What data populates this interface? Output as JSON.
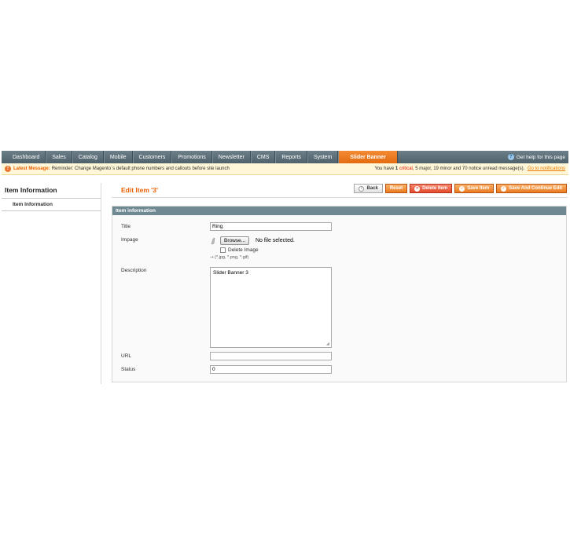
{
  "nav": {
    "items": [
      "Dashboard",
      "Sales",
      "Catalog",
      "Mobile",
      "Customers",
      "Promotions",
      "Newsletter",
      "CMS",
      "Reports",
      "System",
      "Slider Banner"
    ],
    "active_index": 10,
    "help_icon": "question-icon",
    "help_text": "Get help for this page"
  },
  "message": {
    "label": "Latest Message:",
    "text": "Reminder: Change Magento`s default phone numbers and callouts before site launch",
    "summary_prefix": "You have",
    "critical_count": "1",
    "critical_label": "critical",
    "major": ", 5 major, 19 minor and 70 notice unread message(s).",
    "link": "Go to notifications"
  },
  "sidebar": {
    "title": "Item Information",
    "tabs": [
      "Item Information"
    ]
  },
  "page": {
    "title": "Edit Item '3'"
  },
  "buttons": {
    "back": "Back",
    "reset": "Reset",
    "delete": "Delete Item",
    "save": "Save Item",
    "save_continue": "Save And Continue Edit"
  },
  "form": {
    "section_title": "Item information",
    "title_label": "Title",
    "title_value": "Ring",
    "image_label": "Impage",
    "browse_label": "Browse...",
    "no_file": "No file selected.",
    "delete_image_label": "Delete Image",
    "image_hint": "(*.jpg, *.png, *.gif)",
    "description_label": "Description",
    "description_value": "Slider Banner 3",
    "url_label": "URL",
    "url_value": "",
    "status_label": "Status",
    "status_value": "0"
  },
  "colors": {
    "accent": "#eb5e00",
    "nav_bg": "#5a6c75",
    "section_head": "#6f8992"
  }
}
